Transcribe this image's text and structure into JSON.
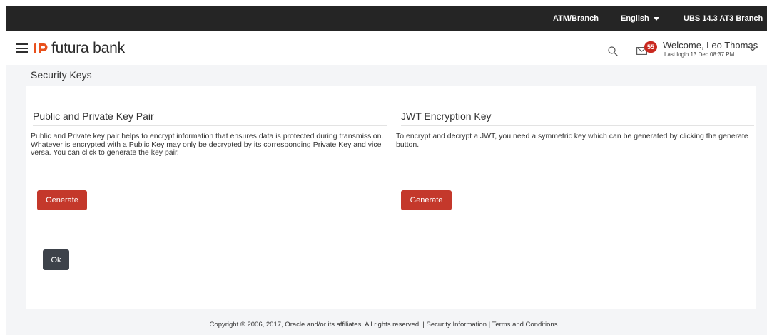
{
  "topbar": {
    "atm_branch": "ATM/Branch",
    "language": "English",
    "branch": "UBS 14.3 AT3 Branch"
  },
  "header": {
    "logo_text": "futura bank",
    "notification_count": "55",
    "welcome": "Welcome, Leo Thomas",
    "last_login": "Last login 13 Dec 08:37 PM"
  },
  "page": {
    "title": "Security Keys"
  },
  "sections": [
    {
      "title": "Public and Private Key Pair",
      "description": "Public and Private key pair helps to encrypt information that ensures data is protected during transmission. Whatever is encrypted with a Public Key may only be decrypted by its corresponding Private Key and vice versa. You can click to generate the key pair.",
      "button_label": "Generate"
    },
    {
      "title": "JWT Encryption Key",
      "description": "To encrypt and decrypt a JWT, you need a symmetric key which can be generated by clicking the generate button.",
      "button_label": "Generate"
    }
  ],
  "actions": {
    "ok_label": "Ok"
  },
  "footer": {
    "copyright": "Copyright © 2006, 2017, Oracle and/or its affiliates. All rights reserved.",
    "separator": "|",
    "security_link": "Security Information",
    "terms_link": "Terms and Conditions"
  },
  "colors": {
    "brand": "#e8501c",
    "primary_button": "#c4382b",
    "secondary_button": "#3d424a",
    "topbar": "#252525",
    "badge": "#c9281f"
  },
  "icons": {
    "menu": "hamburger-icon",
    "search": "search-icon",
    "mail": "mail-icon",
    "profile_menu": "chevron-down-icon"
  }
}
